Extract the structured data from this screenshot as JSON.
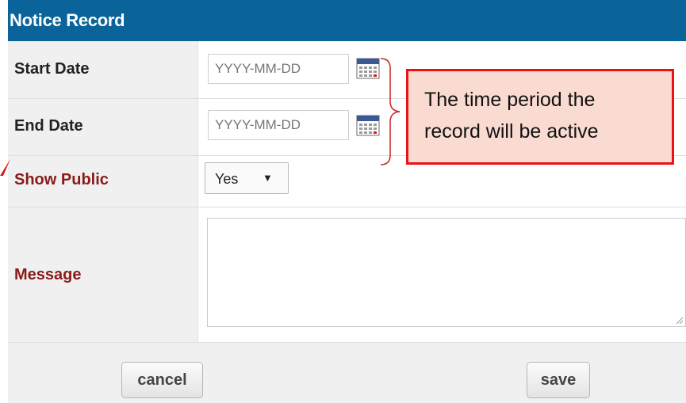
{
  "form": {
    "title": "Notice Record",
    "start_date": {
      "label": "Start Date",
      "placeholder": "YYYY-MM-DD"
    },
    "end_date": {
      "label": "End Date",
      "placeholder": "YYYY-MM-DD"
    },
    "show_public": {
      "label": "Show Public",
      "value": "Yes",
      "arrow": "▼"
    },
    "message": {
      "label": "Message",
      "value": ""
    },
    "buttons": {
      "cancel": "cancel",
      "save": "save"
    }
  },
  "callout": {
    "line1": "The time period the",
    "line2": "record will be active"
  },
  "icons": {
    "calendar": "calendar-icon",
    "dropdown": "chevron-down-icon",
    "resize": "resize-grip-icon",
    "pointer": "red-arrow-icon"
  },
  "colors": {
    "header_bg": "#0a6499",
    "required_label": "#8a1b1b",
    "callout_border": "#ee1111",
    "callout_fill": "#fadbd1"
  }
}
